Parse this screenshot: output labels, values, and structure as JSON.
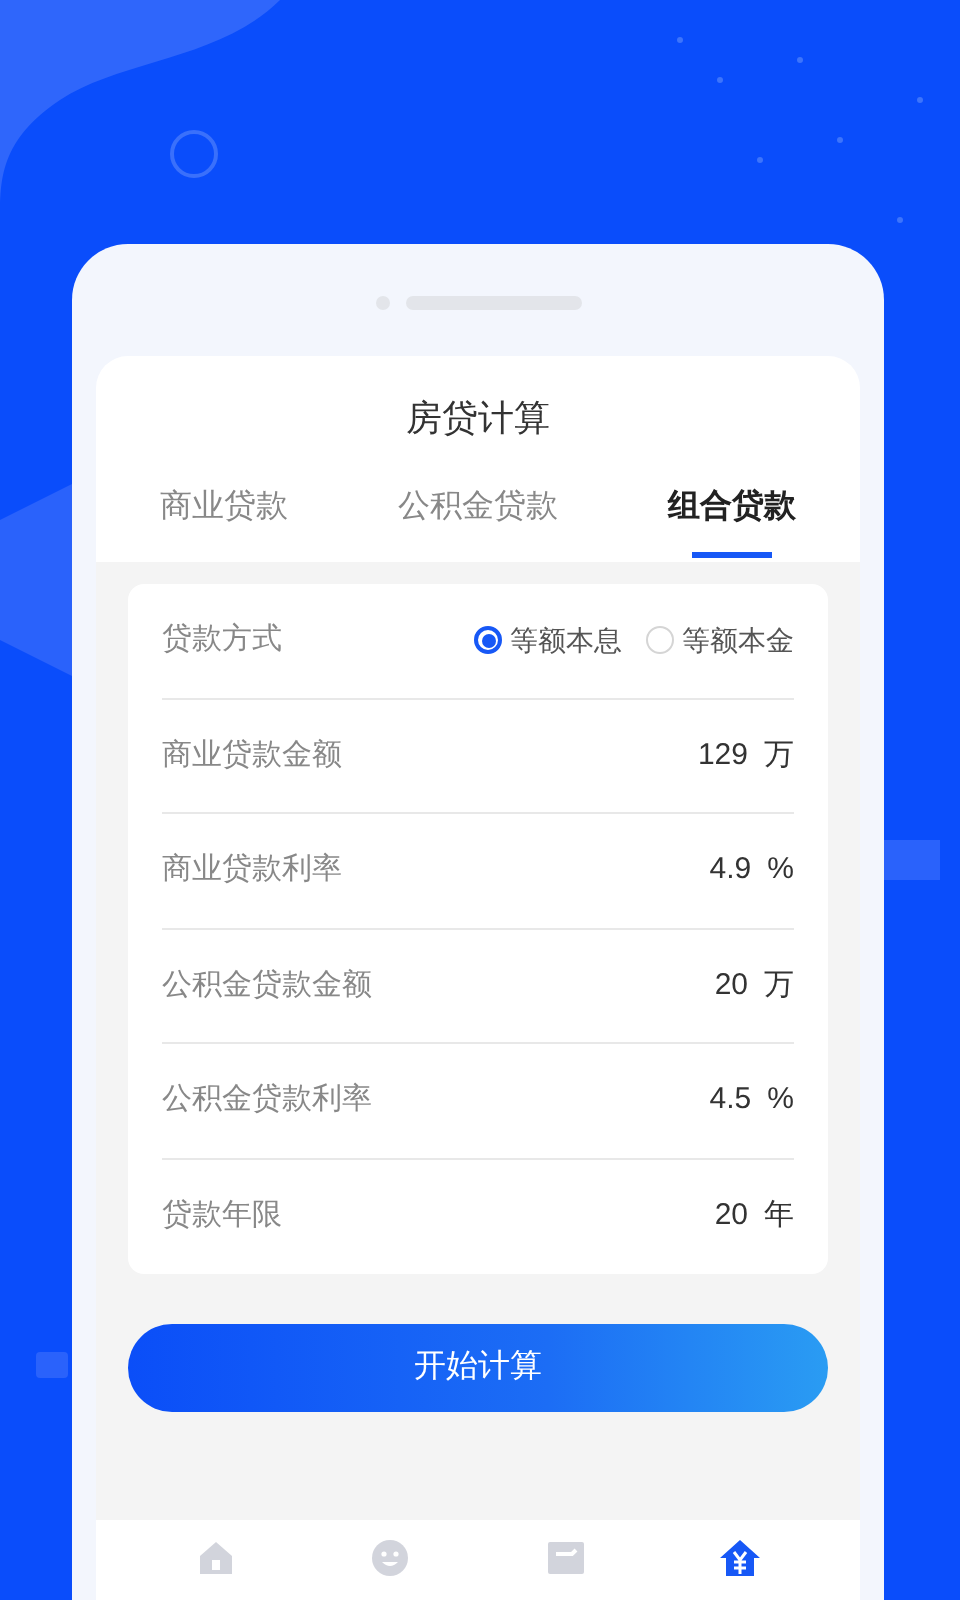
{
  "header": {
    "title": "房贷计算"
  },
  "tabs": [
    {
      "label": "商业贷款",
      "selected": false
    },
    {
      "label": "公积金贷款",
      "selected": false
    },
    {
      "label": "组合贷款",
      "selected": true
    }
  ],
  "loan_method": {
    "label": "贷款方式",
    "options": [
      {
        "label": "等额本息",
        "selected": true
      },
      {
        "label": "等额本金",
        "selected": false
      }
    ]
  },
  "fields": [
    {
      "label": "商业贷款金额",
      "value": "129",
      "unit": "万"
    },
    {
      "label": "商业贷款利率",
      "value": "4.9",
      "unit": "%"
    },
    {
      "label": "公积金贷款金额",
      "value": "20",
      "unit": "万"
    },
    {
      "label": "公积金贷款利率",
      "value": "4.5",
      "unit": "%"
    },
    {
      "label": "贷款年限",
      "value": "20",
      "unit": "年"
    }
  ],
  "calculate_button": "开始计算",
  "bottom_nav": [
    {
      "kind": "home",
      "selected": false
    },
    {
      "kind": "smile",
      "selected": false
    },
    {
      "kind": "card",
      "selected": false
    },
    {
      "kind": "loan",
      "selected": true
    }
  ]
}
